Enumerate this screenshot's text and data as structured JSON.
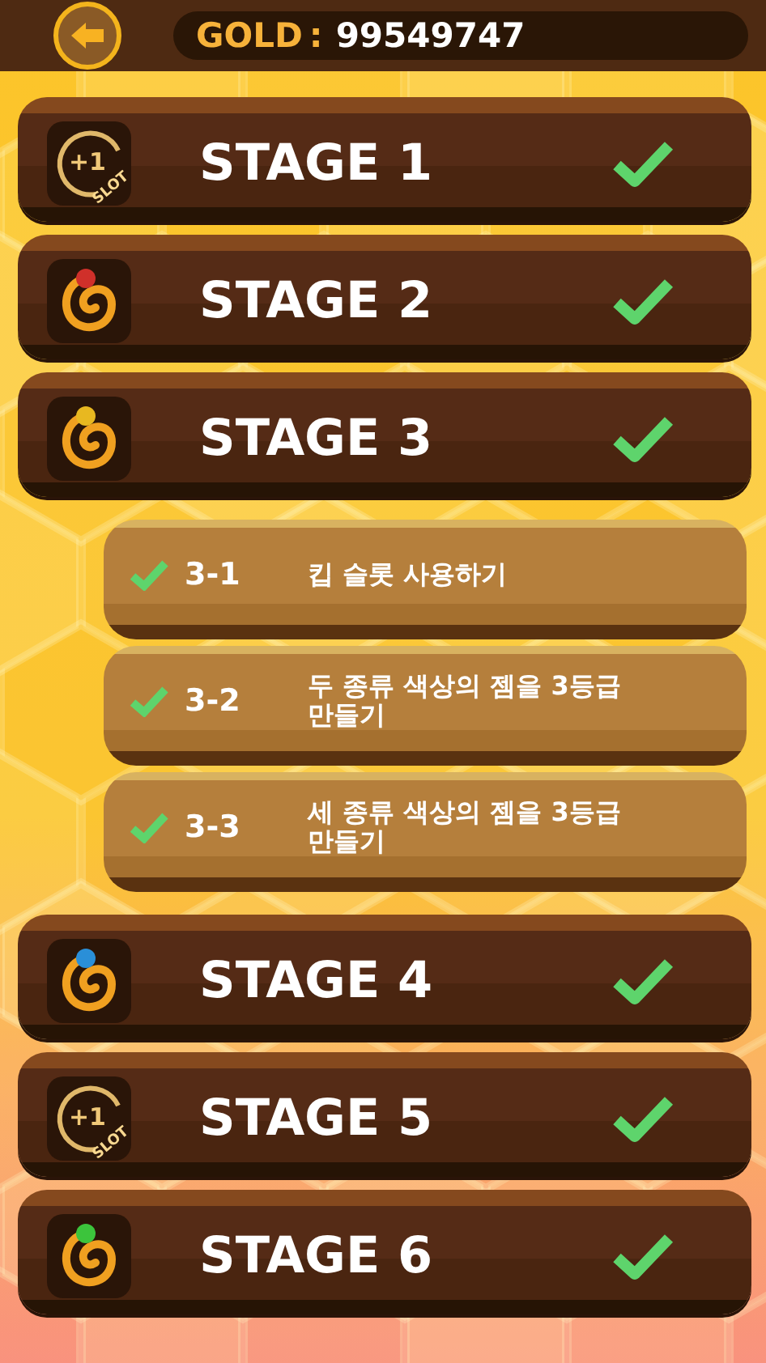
{
  "header": {
    "gold_label": "GOLD",
    "gold_separator": ":",
    "gold_value": "99549747"
  },
  "stages": [
    {
      "title": "STAGE 1",
      "completed": true,
      "expanded": false,
      "icon": {
        "kind": "slot",
        "plus": "+1",
        "label": "SLOT"
      }
    },
    {
      "title": "STAGE 2",
      "completed": true,
      "expanded": false,
      "icon": {
        "kind": "ring",
        "color": "#d0302a"
      }
    },
    {
      "title": "STAGE 3",
      "completed": true,
      "expanded": true,
      "icon": {
        "kind": "ring",
        "color": "#e8b820"
      },
      "missions": [
        {
          "code": "3-1",
          "text": "킵 슬롯 사용하기",
          "completed": true
        },
        {
          "code": "3-2",
          "text": "두 종류 색상의 젬을 3등급 만들기",
          "completed": true
        },
        {
          "code": "3-3",
          "text": "세 종류 색상의 젬을 3등급 만들기",
          "completed": true
        }
      ]
    },
    {
      "title": "STAGE 4",
      "completed": true,
      "expanded": false,
      "icon": {
        "kind": "ring",
        "color": "#2a8fd8"
      }
    },
    {
      "title": "STAGE 5",
      "completed": true,
      "expanded": false,
      "icon": {
        "kind": "slot",
        "plus": "+1",
        "label": "SLOT"
      }
    },
    {
      "title": "STAGE 6",
      "completed": true,
      "expanded": false,
      "icon": {
        "kind": "ring",
        "color": "#3cc43c"
      }
    }
  ]
}
